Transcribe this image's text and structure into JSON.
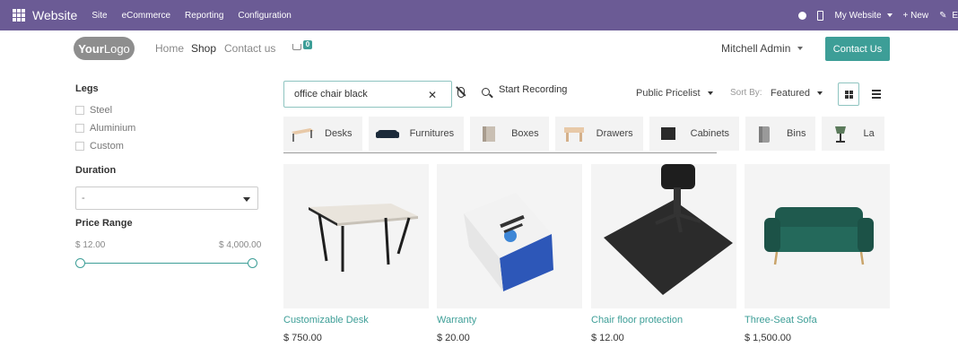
{
  "adminbar": {
    "brand": "Website",
    "menus": [
      "Site",
      "eCommerce",
      "Reporting",
      "Configuration"
    ],
    "my_website": "My Website",
    "new": "+ New",
    "edit": "E"
  },
  "header": {
    "logo_bold": "Your",
    "logo_light": "Logo",
    "nav": [
      "Home",
      "Shop",
      "Contact us"
    ],
    "active_nav": "Shop",
    "cart_count": "0",
    "user": "Mitchell Admin",
    "contact_button": "Contact Us"
  },
  "sidebar": {
    "legs_title": "Legs",
    "legs_options": [
      "Steel",
      "Aluminium",
      "Custom"
    ],
    "duration_title": "Duration",
    "duration_value": "-",
    "price_title": "Price Range",
    "price_min": "$ 12.00",
    "price_max": "$ 4,000.00"
  },
  "toolbar": {
    "search_value": "office chair black",
    "record_label": "Start Recording",
    "pricelist": "Public Pricelist",
    "sort_label": "Sort By:",
    "sort_value": "Featured"
  },
  "categories": [
    "Desks",
    "Furnitures",
    "Boxes",
    "Drawers",
    "Cabinets",
    "Bins",
    "La"
  ],
  "products": [
    {
      "name": "Customizable Desk",
      "price": "$ 750.00"
    },
    {
      "name": "Warranty",
      "price": "$ 20.00"
    },
    {
      "name": "Chair floor protection",
      "price": "$ 12.00"
    },
    {
      "name": "Three-Seat Sofa",
      "price": "$ 1,500.00"
    }
  ],
  "colors": {
    "adminbar": "#6b5b95",
    "accent": "#3d9e97"
  }
}
